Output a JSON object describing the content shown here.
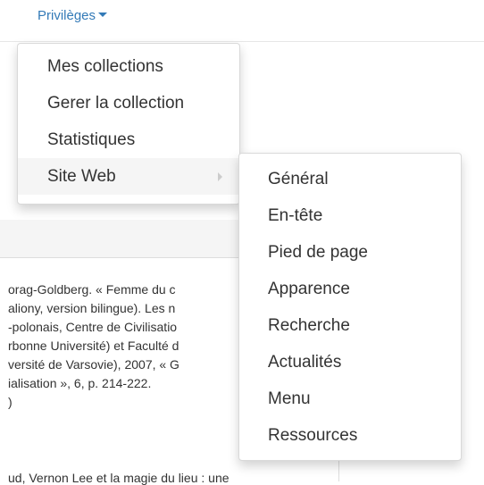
{
  "navbar": {
    "privileges_label": "Privilèges"
  },
  "privileges_menu": {
    "items": [
      {
        "label": "Mes collections"
      },
      {
        "label": "Gerer la collection"
      },
      {
        "label": "Statistiques"
      },
      {
        "label": "Site Web"
      }
    ]
  },
  "website_submenu": {
    "items": [
      {
        "label": "Général"
      },
      {
        "label": "En-tête"
      },
      {
        "label": "Pied de page"
      },
      {
        "label": "Apparence"
      },
      {
        "label": "Recherche"
      },
      {
        "label": "Actualités"
      },
      {
        "label": "Menu"
      },
      {
        "label": "Ressources"
      }
    ]
  },
  "background_text": {
    "lines": [
      "orag-Goldberg. « Femme du c",
      "aliony, version bilingue). Les n",
      "-polonais, Centre de Civilisatio",
      "rbonne Université) et Faculté d",
      "versité de Varsovie), 2007, « G",
      "ialisation », 6, p. 214-222.",
      ")",
      "ud, Vernon Lee et la magie du lieu : une"
    ]
  },
  "colors": {
    "link": "#337ab7",
    "text": "#333333",
    "active_bg": "#f5f5f5"
  }
}
